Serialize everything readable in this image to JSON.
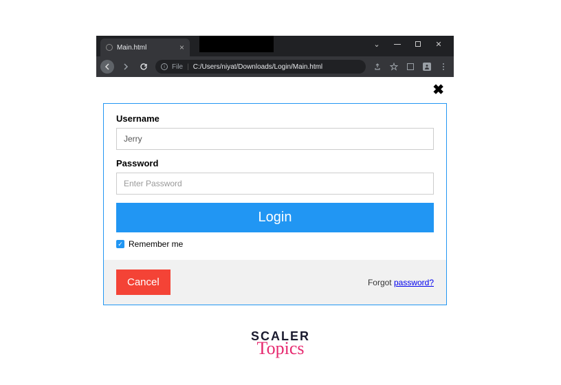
{
  "browser": {
    "tab_title": "Main.html",
    "address": {
      "file_label": "File",
      "path": "C:/Users/niyat/Downloads/Login/Main.html"
    }
  },
  "login": {
    "username_label": "Username",
    "username_value": "Jerry",
    "password_label": "Password",
    "password_placeholder": "Enter Password",
    "login_button": "Login",
    "remember_label": "Remember me",
    "cancel_button": "Cancel",
    "forgot_prefix": "Forgot ",
    "forgot_link": "password?"
  },
  "branding": {
    "scaler": "SCALER",
    "topics": "Topics"
  }
}
